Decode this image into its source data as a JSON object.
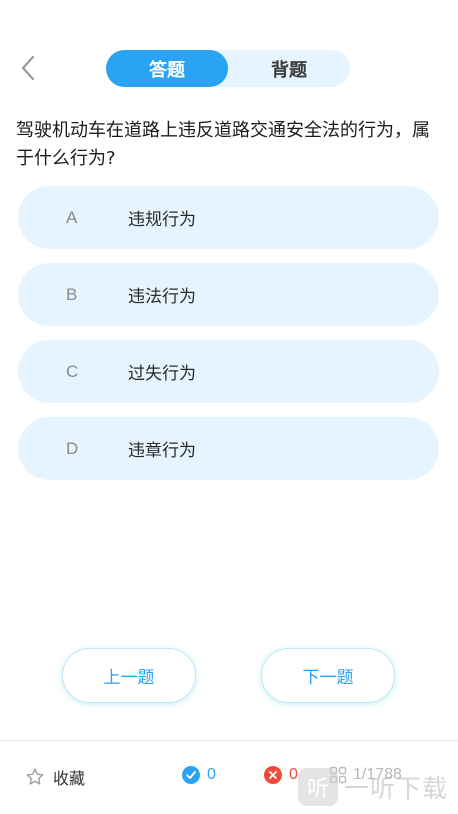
{
  "header": {
    "back_icon": "chevron-left-icon",
    "tabs": [
      {
        "label": "答题",
        "active": true
      },
      {
        "label": "背题",
        "active": false
      }
    ]
  },
  "question": {
    "text": "驾驶机动车在道路上违反道路交通安全法的行为，属于什么行为?"
  },
  "options": [
    {
      "letter": "A",
      "text": "违规行为"
    },
    {
      "letter": "B",
      "text": "违法行为"
    },
    {
      "letter": "C",
      "text": "过失行为"
    },
    {
      "letter": "D",
      "text": "违章行为"
    }
  ],
  "navigation": {
    "prev_label": "上一题",
    "next_label": "下一题"
  },
  "footer": {
    "favorite_label": "收藏",
    "favorite_icon": "star-outline-icon",
    "correct_count": "0",
    "correct_icon": "check-circle-icon",
    "wrong_count": "0",
    "wrong_icon": "x-circle-icon",
    "progress": "1/1788",
    "progress_icon": "grid-icon"
  },
  "watermark": {
    "logo_text": "听",
    "text": "一听下载"
  },
  "colors": {
    "accent": "#2aa3f5",
    "option_bg": "#e6f4ff",
    "correct": "#2aa3f5",
    "wrong": "#f04a3a"
  }
}
